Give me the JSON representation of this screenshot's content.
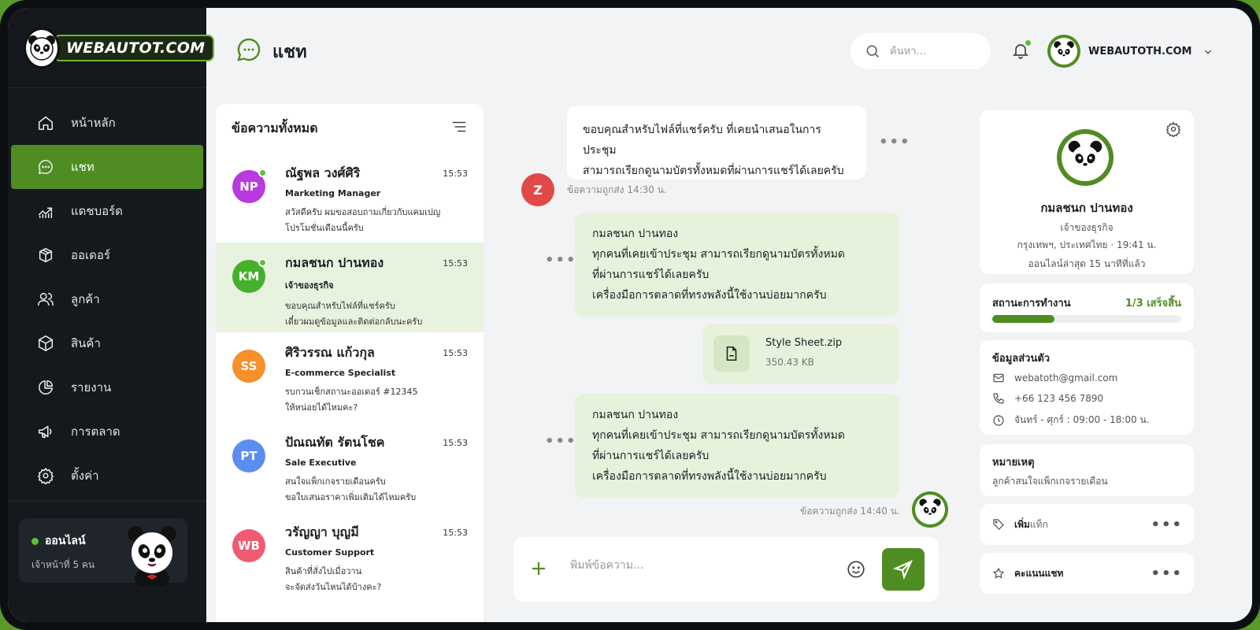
{
  "brand": {
    "logo_text": "WEBAUTOT.COM"
  },
  "sidebar": {
    "items": [
      {
        "label": "หน้าหลัก",
        "icon": "home-icon"
      },
      {
        "label": "แชท",
        "icon": "chat-icon",
        "active": true
      },
      {
        "label": "แดชบอร์ด",
        "icon": "dashboard-icon"
      },
      {
        "label": "ออเดอร์",
        "icon": "order-icon"
      },
      {
        "label": "ลูกค้า",
        "icon": "users-icon"
      },
      {
        "label": "สินค้า",
        "icon": "box-icon"
      },
      {
        "label": "รายงาน",
        "icon": "report-icon"
      },
      {
        "label": "การตลาด",
        "icon": "megaphone-icon"
      },
      {
        "label": "ตั้งค่า",
        "icon": "gear-icon"
      }
    ],
    "status": {
      "label": "ออนไลน์",
      "sub": "เจ้าหน้าที่ 5 คน"
    }
  },
  "header": {
    "title": "แชท",
    "search_placeholder": "ค้นหา...",
    "user_name": "WEBAUTOTH.COM"
  },
  "conversations": {
    "title": "ข้อความทั้งหมด",
    "items": [
      {
        "initials": "NP",
        "color": "#b83be0",
        "name": "ณัฐพล วงศ์ศิริ",
        "role": "Marketing Manager",
        "time": "15:53",
        "msg1": "สวัสดีครับ ผมขอสอบถามเกี่ยวกับแคมเปญ",
        "msg2": "โปรโมชั่นเดือนนี้ครับ",
        "online": true
      },
      {
        "initials": "KM",
        "color": "#45b02c",
        "name": "กมลชนก ปานทอง",
        "role": "เจ้าของธุรกิจ",
        "time": "15:53",
        "msg1": "ขอบคุณสำหรับไฟล์ที่แชร์ครับ",
        "msg2": "เดี๋ยวผมดูข้อมูลและติดต่อกลับนะครับ",
        "online": true,
        "active": true
      },
      {
        "initials": "SS",
        "color": "#f5902a",
        "name": "ศิริวรรณ แก้วกุล",
        "role": "E-commerce Specialist",
        "time": "15:53",
        "msg1": "รบกวนเช็กสถานะออเดอร์ #12345",
        "msg2": "ให้หน่อยได้ไหมคะ?",
        "online": false
      },
      {
        "initials": "PT",
        "color": "#5b8ef0",
        "name": "ปัณณทัต รัตนโชค",
        "role": "Sale Executive",
        "time": "15:53",
        "msg1": "สนใจแพ็กเกจรายเดือนครับ",
        "msg2": "ขอใบเสนอราคาเพิ่มเติมได้ไหมครับ",
        "online": false
      },
      {
        "initials": "WB",
        "color": "#ef5b70",
        "name": "วรัญญา บุญมี",
        "role": "Customer Support",
        "time": "15:53",
        "msg1": "สินค้าที่สั่งไปเมื่อวาน",
        "msg2": "จะจัดส่งวันไหนได้บ้างคะ?",
        "online": false
      }
    ]
  },
  "chat": {
    "incoming": {
      "line1": "ขอบคุณสำหรับไฟล์ที่แชร์ครับ ที่เคยนำเสนอในการประชุม",
      "line2": "สามารถเรียกดูนามบัตรทั้งหมดที่ผ่านการแชร์ได้เลยครับ",
      "sender_initial": "Z",
      "meta": "ข้อความถูกส่ง 14:30 น."
    },
    "outgoing1": {
      "line1": "กมลชนก ปานทอง",
      "line2": "ทุกคนที่เคยเข้าประชุม สามารถเรียกดูนามบัตรทั้งหมด",
      "line3": "ที่ผ่านการแชร์ได้เลยครับ",
      "line4": "เครื่องมือการตลาดที่ทรงพลังนี้ใช้งานบ่อยมากครับ"
    },
    "file": {
      "name": "Style Sheet.zip",
      "size": "350.43 KB"
    },
    "outgoing2": {
      "line1": "กมลชนก ปานทอง",
      "line2": "ทุกคนที่เคยเข้าประชุม สามารถเรียกดูนามบัตรทั้งหมด",
      "line3": "ที่ผ่านการแชร์ได้เลยครับ",
      "line4": "เครื่องมือการตลาดที่ทรงพลังนี้ใช้งานบ่อยมากครับ"
    },
    "out_meta": "ข้อความถูกส่ง 14:40 น.",
    "dots": "•••",
    "composer_placeholder": "พิมพ์ข้อความ..."
  },
  "profile": {
    "name": "กมลชนก ปานทอง",
    "role": "เจ้าของธุรกิจ",
    "location": "กรุงเทพฯ, ประเทศไทย · 19:41 น.",
    "last_seen": "ออนไลน์ล่าสุด 15 นาทีที่แล้ว"
  },
  "work_status": {
    "label": "สถานะการทำงาน",
    "value": "1/3 เสร็จสิ้น",
    "progress_fraction": 0.33
  },
  "personal": {
    "title": "ข้อมูลส่วนตัว",
    "email": "webatoth@gmail.com",
    "phone": "+66 123 456 7890",
    "hours": "จันทร์ - ศุกร์ : 09:00 - 18:00 น."
  },
  "notes": {
    "title": "หมายเหตุ",
    "text": "ลูกค้าสนใจแพ็กเกจรายเดือน"
  },
  "actions": {
    "add_tag_bold": "เพิ่ม",
    "add_tag_rest": "แท็ก",
    "rate_chat": "คะแนนแชท",
    "dots": "•••"
  },
  "colors": {
    "accent": "#4f8d22",
    "sidebar": "#15191e",
    "bubble_out": "#e6f2dc",
    "online": "#5cc235"
  }
}
